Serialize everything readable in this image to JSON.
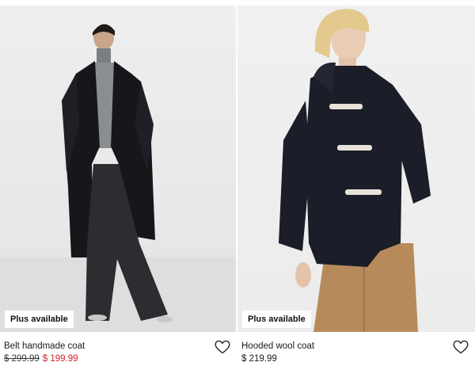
{
  "products": [
    {
      "name": "Belt handmade coat",
      "badge": "Plus available",
      "price_original": "$ 299.99",
      "price_sale": "$ 199.99"
    },
    {
      "name": "Hooded wool coat",
      "badge": "Plus available",
      "price": "$ 219.99"
    }
  ],
  "colors": {
    "sale_price": "#d2232a",
    "coat_black": "#14141a",
    "coat_navy": "#1b1d28",
    "skirt_camel": "#b68a5a"
  },
  "icons": {
    "favorite": "heart-outline-icon"
  }
}
